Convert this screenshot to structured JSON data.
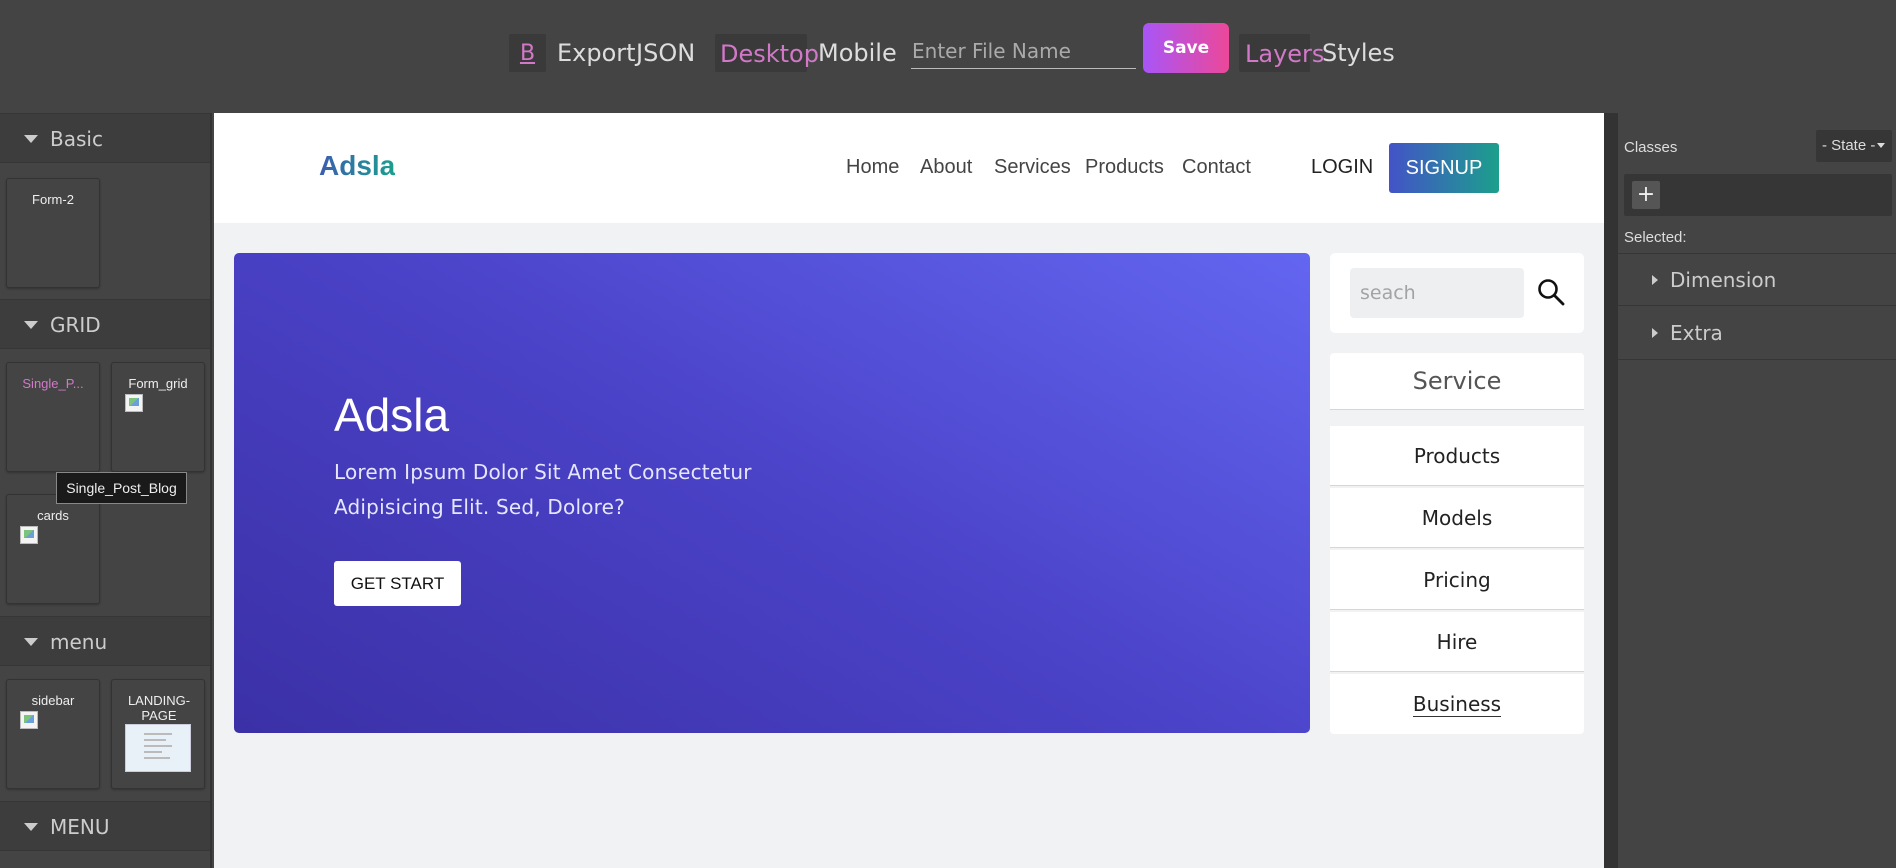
{
  "toolbar": {
    "bold_label": "B",
    "export_label": "Export",
    "json_label": "JSON",
    "desktop_label": "Desktop",
    "mobile_label": "Mobile",
    "filename_placeholder": "Enter File Name",
    "save_label": "Save",
    "layers_label": "Layers",
    "styles_label": "Styles"
  },
  "blocks_panel": {
    "categories": [
      {
        "label": "Basic"
      },
      {
        "label": "GRID"
      },
      {
        "label": "menu"
      },
      {
        "label": "MENU"
      }
    ],
    "basic_blocks": [
      "Form-2"
    ],
    "grid_blocks": [
      "Single_P...",
      "Form_grid",
      "cards"
    ],
    "menu_blocks": [
      "sidebar",
      "LANDING-PAGE"
    ],
    "tooltip": "Single_Post_Blog"
  },
  "site": {
    "brand": "Adsla",
    "nav": [
      "Home",
      "About",
      "Services",
      "Products",
      "Contact"
    ],
    "login": "LOGIN",
    "signup": "SIGNUP",
    "hero": {
      "title": "Adsla",
      "text": "Lorem Ipsum Dolor Sit Amet Consectetur Adipisicing Elit. Sed, Dolore?",
      "button": "GET START"
    },
    "search_placeholder": "seach",
    "service_title": "Service",
    "service_items": [
      "Products",
      "Models",
      "Pricing",
      "Hire",
      "Business"
    ]
  },
  "style_panel": {
    "classes_label": "Classes",
    "state_label": "- State -",
    "add_label": "+",
    "selected_label": "Selected:",
    "sectors": [
      "Dimension",
      "Extra"
    ]
  },
  "colors": {
    "accent_pink": "#d278c9",
    "panel_bg": "#444444",
    "hero_gradient_start": "#3b30a6",
    "hero_gradient_end": "#6366f1"
  }
}
